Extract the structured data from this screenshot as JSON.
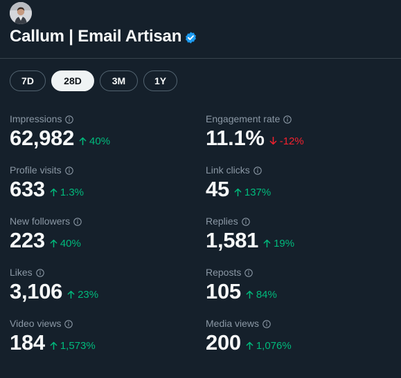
{
  "profile": {
    "name": "Callum | Email Artisan",
    "verified": true
  },
  "time_ranges": {
    "selected": "28D",
    "options": [
      "7D",
      "28D",
      "3M",
      "1Y"
    ]
  },
  "colors": {
    "background": "#15202b",
    "positive": "#00ba7c",
    "negative": "#f4212e",
    "verified_badge": "#1d9bf0"
  },
  "metrics": {
    "impressions": {
      "label": "Impressions",
      "value": "62,982",
      "change": "40%",
      "direction": "up"
    },
    "engagement_rate": {
      "label": "Engagement rate",
      "value": "11.1%",
      "change": "-12%",
      "direction": "down"
    },
    "profile_visits": {
      "label": "Profile visits",
      "value": "633",
      "change": "1.3%",
      "direction": "up"
    },
    "link_clicks": {
      "label": "Link clicks",
      "value": "45",
      "change": "137%",
      "direction": "up"
    },
    "new_followers": {
      "label": "New followers",
      "value": "223",
      "change": "40%",
      "direction": "up"
    },
    "replies": {
      "label": "Replies",
      "value": "1,581",
      "change": "19%",
      "direction": "up"
    },
    "likes": {
      "label": "Likes",
      "value": "3,106",
      "change": "23%",
      "direction": "up"
    },
    "reposts": {
      "label": "Reposts",
      "value": "105",
      "change": "84%",
      "direction": "up"
    },
    "video_views": {
      "label": "Video views",
      "value": "184",
      "change": "1,573%",
      "direction": "up"
    },
    "media_views": {
      "label": "Media views",
      "value": "200",
      "change": "1,076%",
      "direction": "up"
    }
  }
}
